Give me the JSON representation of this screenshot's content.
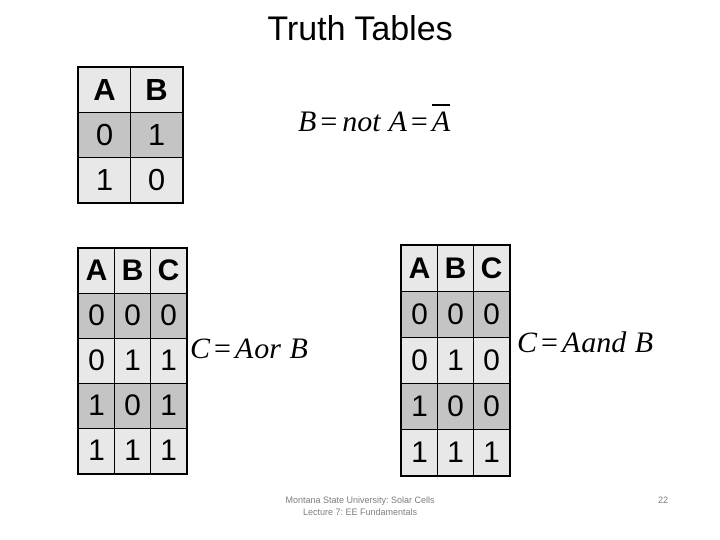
{
  "slide": {
    "title": "Truth Tables",
    "page_number": "22",
    "footer_line1": "Montana State University: Solar Cells",
    "footer_line2": "Lecture 7: EE Fundamentals",
    "background_color": "#ffffff",
    "cell_light_color": "#e8e8e8",
    "cell_dark_color": "#c4c4c4",
    "border_color": "#000000",
    "footer_color": "#808080"
  },
  "tables": {
    "not_table": {
      "name": "NOT truth table",
      "headers": [
        "A",
        "B"
      ],
      "rows": [
        {
          "shade": "dark",
          "cells": [
            "0",
            "1"
          ]
        },
        {
          "shade": "light",
          "cells": [
            "1",
            "0"
          ]
        }
      ]
    },
    "or_table": {
      "name": "OR truth table",
      "headers": [
        "A",
        "B",
        "C"
      ],
      "rows": [
        {
          "shade": "dark",
          "cells": [
            "0",
            "0",
            "0"
          ]
        },
        {
          "shade": "light",
          "cells": [
            "0",
            "1",
            "1"
          ]
        },
        {
          "shade": "dark",
          "cells": [
            "1",
            "0",
            "1"
          ]
        },
        {
          "shade": "light",
          "cells": [
            "1",
            "1",
            "1"
          ]
        }
      ]
    },
    "and_table": {
      "name": "AND truth table",
      "headers": [
        "A",
        "B",
        "C"
      ],
      "rows": [
        {
          "shade": "dark",
          "cells": [
            "0",
            "0",
            "0"
          ]
        },
        {
          "shade": "light",
          "cells": [
            "0",
            "1",
            "0"
          ]
        },
        {
          "shade": "dark",
          "cells": [
            "1",
            "0",
            "0"
          ]
        },
        {
          "shade": "light",
          "cells": [
            "1",
            "1",
            "1"
          ]
        }
      ]
    }
  },
  "equations": {
    "not_eq": {
      "full_text": "B = not A = Ä",
      "lhs": "B",
      "eq1": "=",
      "op": "not",
      "operand": "A",
      "eq2": "=",
      "overlined": "A"
    },
    "or_eq": {
      "full_text": "C = A or B",
      "lhs": "C",
      "eq1": "=",
      "operand_a": "A",
      "op": "or",
      "operand_b": "B"
    },
    "and_eq": {
      "full_text": "C = A and B",
      "lhs": "C",
      "eq1": "=",
      "operand_a": "A",
      "op": "and",
      "operand_b": "B"
    }
  }
}
